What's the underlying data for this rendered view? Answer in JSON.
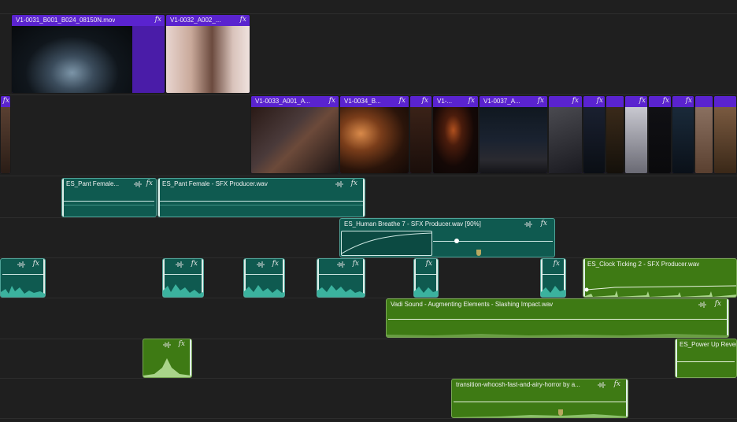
{
  "video_track_2": {
    "clips": [
      {
        "label": "V1-0031_B001_B024_08150N.mov",
        "fx": "fx"
      },
      {
        "label": "V1-0032_A002_...",
        "fx": "fx"
      }
    ]
  },
  "video_track_1": {
    "clips": [
      {
        "label": "",
        "fx": "fx"
      },
      {
        "label": "V1-0033_A001_A...",
        "fx": "fx"
      },
      {
        "label": "V1-0034_B...",
        "fx": "fx"
      },
      {
        "label": "",
        "fx": "fx"
      },
      {
        "label": "V1-...",
        "fx": "fx"
      },
      {
        "label": "V1-0037_A...",
        "fx": "fx"
      },
      {
        "label": "",
        "fx": "fx"
      },
      {
        "label": "",
        "fx": "fx"
      },
      {
        "label": "",
        "fx": "fx"
      },
      {
        "label": "",
        "fx": "fx"
      },
      {
        "label": "",
        "fx": "fx"
      }
    ]
  },
  "audio_track_1": {
    "clips": [
      {
        "label": "ES_Pant Female...",
        "fx": "fx"
      },
      {
        "label": "ES_Pant Female - SFX Producer.wav",
        "fx": "fx"
      }
    ]
  },
  "audio_track_2": {
    "clips": [
      {
        "label": "ES_Human Breathe 7 - SFX Producer.wav [90%]",
        "fx": "fx"
      }
    ]
  },
  "audio_track_3": {
    "clips": [
      {
        "label": "",
        "fx": "fx"
      },
      {
        "label": "",
        "fx": "fx"
      },
      {
        "label": "",
        "fx": "fx"
      },
      {
        "label": "",
        "fx": "fx"
      },
      {
        "label": "",
        "fx": "fx"
      },
      {
        "label": "",
        "fx": "fx"
      },
      {
        "label": "ES_Clock Ticking 2 - SFX Producer.wav",
        "fx": ""
      }
    ]
  },
  "audio_track_4": {
    "clips": [
      {
        "label": "Vadi Sound - Augmenting Elements - Slashing Impact.wav",
        "fx": "fx"
      }
    ]
  },
  "audio_track_5": {
    "clips": [
      {
        "label": "",
        "fx": "fx"
      },
      {
        "label": "ES_Power Up Rever",
        "fx": ""
      }
    ]
  },
  "audio_track_6": {
    "clips": [
      {
        "label": "transition-whoosh-fast-and-airy-horror by a...",
        "fx": "fx"
      }
    ]
  },
  "colors": {
    "video_clip": "#4a1ca8",
    "audio_teal": "#0f5a50",
    "audio_green": "#3e7a14",
    "background": "#1f1f1f"
  }
}
